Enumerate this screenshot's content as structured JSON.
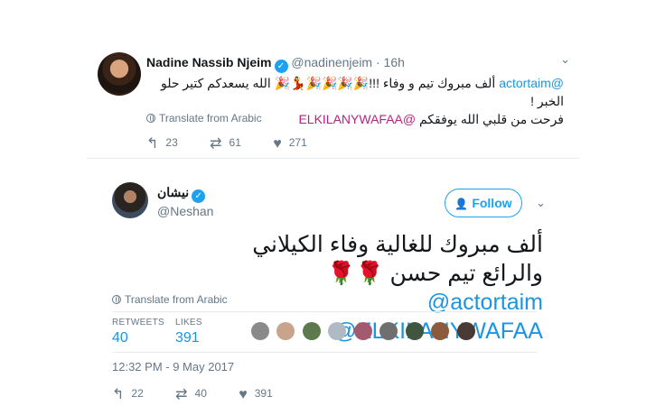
{
  "quoted": {
    "name": "Nadine Nassib Njeim",
    "handle": "@nadinenjeim",
    "time": "· 16h",
    "line1_mention": "@actortaim",
    "line1_text": " ألف مبروك تيم و وفاء !!!🎉🎉🎉🎉💃🎉 الله يسعدكم كتير حلو الخبر !",
    "line2_mention": "@ELKILANYWAFAA",
    "line2_text": "فرحت من قلبي الله يوفقكم ",
    "translate": "Translate from Arabic",
    "reply_count": "23",
    "retweet_count": "61",
    "like_count": "271"
  },
  "tweet": {
    "name": "نيشان",
    "handle": "@Neshan",
    "follow_label": "Follow",
    "body_text": "ألف مبروك للغالية وفاء الكيلاني والرائع تيم حسن",
    "roses": "🌹🌹",
    "mention1": "@actortaim",
    "mention2": "@ELKILANYWAFAA",
    "translate": "Translate from Arabic",
    "retweets_label": "RETWEETS",
    "retweets_value": "40",
    "likes_label": "LIKES",
    "likes_value": "391",
    "timestamp": "12:32 PM - 9 May 2017",
    "reply_count": "22",
    "retweet_count": "40",
    "like_count": "391"
  },
  "colors": {
    "link": "#1b95e0",
    "verified": "#1da1f2",
    "muted": "#657786"
  },
  "icons": [
    "verified-badge-icon",
    "caret-down-icon",
    "globe-icon",
    "reply-icon",
    "retweet-icon",
    "heart-icon",
    "follow-person-icon"
  ]
}
